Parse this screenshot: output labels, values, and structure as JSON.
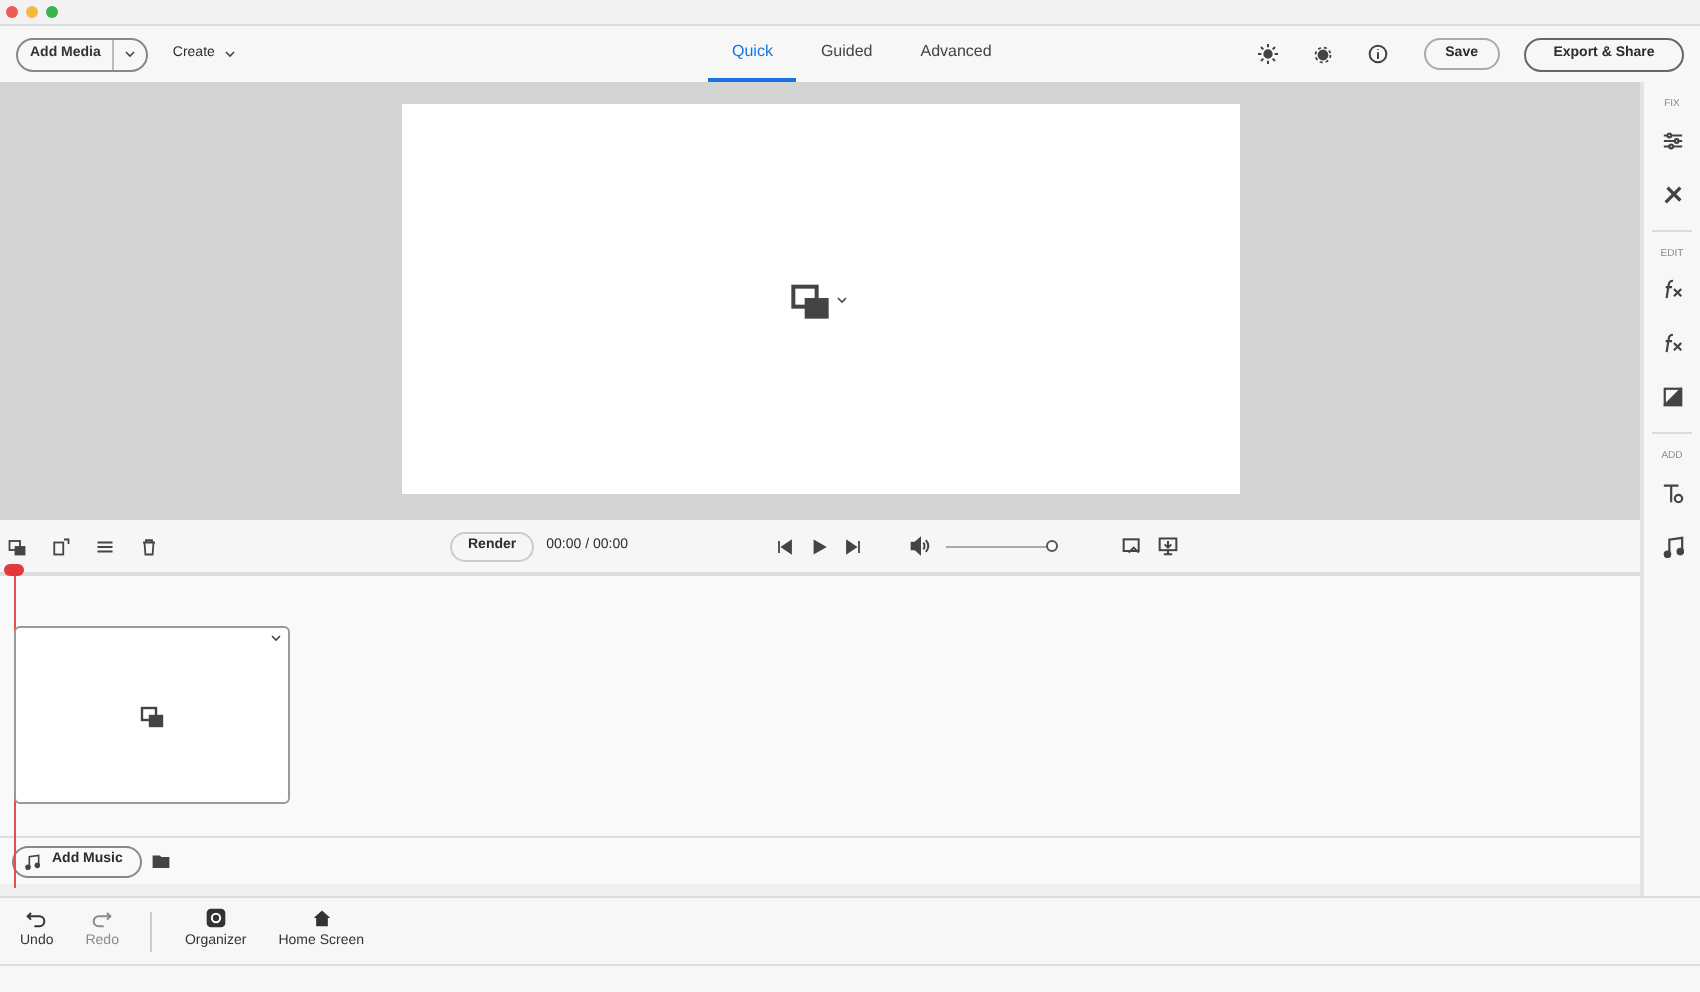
{
  "toolbar": {
    "add_media": "Add Media",
    "create": "Create",
    "save": "Save",
    "export": "Export & Share"
  },
  "tabs": [
    {
      "label": "Quick",
      "selected": true
    },
    {
      "label": "Guided",
      "selected": false
    },
    {
      "label": "Advanced",
      "selected": false
    }
  ],
  "timeline_toolbar": {
    "render": "Render",
    "time": "00:00 / 00:00",
    "volume": {
      "level": 1.0
    }
  },
  "add_music": "Add Music",
  "side_panel": [
    {
      "label": "FIX"
    },
    {
      "label": "EDIT"
    },
    {
      "label": "ADD"
    }
  ],
  "bottom_bar": [
    {
      "label": "Undo",
      "disabled": false
    },
    {
      "label": "Redo",
      "disabled": true
    },
    {
      "label": "Organizer",
      "disabled": false
    },
    {
      "label": "Home Screen",
      "disabled": false
    }
  ]
}
